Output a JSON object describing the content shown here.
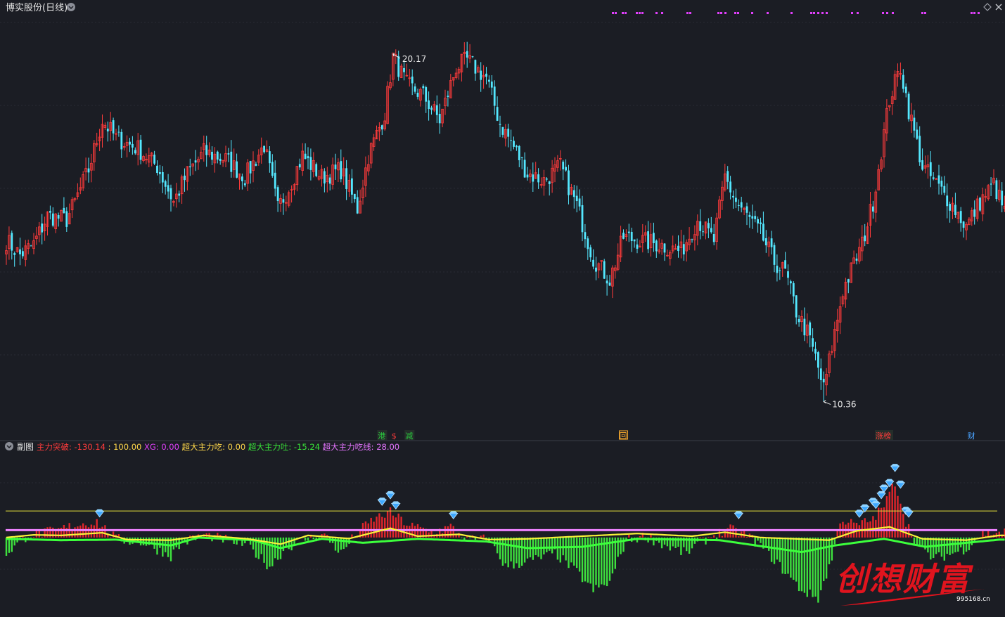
{
  "header": {
    "title": "博实股份(日线)",
    "dropdown_icon": "chevron-down-icon",
    "settings_icon": "diamond-icon",
    "close_icon": "close-icon"
  },
  "main_chart": {
    "type": "candlestick",
    "high_label": "20.17",
    "low_label": "10.36",
    "high_value": 20.17,
    "low_value": 10.36,
    "y_range": [
      9.4,
      21.3
    ],
    "up_color": "#ff3b3b",
    "down_color": "#54e8ff",
    "event_markers": [
      {
        "label": "港",
        "color": "#29c43d",
        "style": "box",
        "index": 137
      },
      {
        "label": "$",
        "color": "#ff3b3b",
        "style": "text",
        "index": 142
      },
      {
        "label": "减",
        "color": "#29c43d",
        "style": "box",
        "index": 147
      },
      {
        "label": "回",
        "color": "#ffae2e",
        "style": "outline",
        "index": 225
      },
      {
        "label": "涨榜",
        "color": "#ff3b3b",
        "style": "box",
        "index": 320
      },
      {
        "label": "财",
        "color": "#4aa3ff",
        "style": "text",
        "index": 352
      }
    ]
  },
  "sub_chart": {
    "label": "副图",
    "indicators": [
      {
        "name": "主力突破",
        "value": "-130.14",
        "color": "#ff3b3b"
      },
      {
        "name": "",
        "value": "100.00",
        "color": "#ffd84a"
      },
      {
        "name": "XG",
        "value": "0.00",
        "color": "#e040fb"
      },
      {
        "name": "超大主力吃",
        "value": "0.00",
        "color": "#ffd84a"
      },
      {
        "name": "超大主力吐",
        "value": "-15.24",
        "color": "#39e639"
      },
      {
        "name": "超大主力吃线",
        "value": "28.00",
        "color": "#e575ff"
      }
    ],
    "reference_lines": {
      "yellow": 100,
      "magenta": 28
    },
    "y_range": [
      -300,
      310
    ],
    "bar_up_color": "#e0252b",
    "bar_down_color": "#3ee03e",
    "line_colors": {
      "yellow_curve": "#f7f23a",
      "green_curve": "#3cff3c"
    }
  },
  "watermark": {
    "text": "创想财富",
    "url": "995168.cn"
  },
  "chart_data": {
    "type": "candlestick",
    "anchors": [
      [
        0,
        14.9
      ],
      [
        5,
        14.5
      ],
      [
        10,
        14.8
      ],
      [
        15,
        15.6
      ],
      [
        22,
        15.5
      ],
      [
        25,
        16.0
      ],
      [
        30,
        16.9
      ],
      [
        35,
        18.3
      ],
      [
        40,
        17.8
      ],
      [
        48,
        17.5
      ],
      [
        55,
        17.0
      ],
      [
        61,
        16.0
      ],
      [
        66,
        16.8
      ],
      [
        72,
        17.4
      ],
      [
        80,
        17.2
      ],
      [
        87,
        16.7
      ],
      [
        94,
        17.6
      ],
      [
        99,
        15.8
      ],
      [
        103,
        16.4
      ],
      [
        108,
        17.3
      ],
      [
        115,
        16.7
      ],
      [
        122,
        16.9
      ],
      [
        128,
        15.8
      ],
      [
        132,
        17.3
      ],
      [
        138,
        18.5
      ],
      [
        141,
        20.1
      ],
      [
        146,
        19.3
      ],
      [
        152,
        19.0
      ],
      [
        158,
        18.3
      ],
      [
        164,
        19.8
      ],
      [
        168,
        20.0
      ],
      [
        175,
        19.5
      ],
      [
        180,
        18.2
      ],
      [
        184,
        17.7
      ],
      [
        190,
        16.8
      ],
      [
        196,
        16.6
      ],
      [
        202,
        17.0
      ],
      [
        208,
        15.9
      ],
      [
        214,
        14.4
      ],
      [
        220,
        13.8
      ],
      [
        225,
        15.0
      ],
      [
        231,
        14.9
      ],
      [
        238,
        14.8
      ],
      [
        246,
        14.6
      ],
      [
        252,
        15.5
      ],
      [
        258,
        14.9
      ],
      [
        262,
        16.7
      ],
      [
        266,
        16.0
      ],
      [
        270,
        15.6
      ],
      [
        275,
        15.1
      ],
      [
        280,
        14.3
      ],
      [
        284,
        14.0
      ],
      [
        288,
        12.9
      ],
      [
        292,
        12.3
      ],
      [
        295,
        11.6
      ],
      [
        298,
        10.7
      ],
      [
        301,
        11.9
      ],
      [
        305,
        13.5
      ],
      [
        312,
        14.8
      ],
      [
        316,
        16.0
      ],
      [
        322,
        18.9
      ],
      [
        326,
        19.8
      ],
      [
        329,
        18.6
      ],
      [
        334,
        17.0
      ],
      [
        339,
        16.5
      ],
      [
        345,
        15.9
      ],
      [
        350,
        15.3
      ],
      [
        355,
        16.0
      ],
      [
        360,
        16.5
      ],
      [
        364,
        15.7
      ]
    ],
    "sub_anchors": [
      [
        0,
        -60
      ],
      [
        8,
        10
      ],
      [
        18,
        25
      ],
      [
        26,
        50
      ],
      [
        33,
        60
      ],
      [
        40,
        -5
      ],
      [
        50,
        -20
      ],
      [
        60,
        -70
      ],
      [
        64,
        -20
      ],
      [
        72,
        10
      ],
      [
        80,
        -8
      ],
      [
        88,
        -30
      ],
      [
        96,
        -110
      ],
      [
        102,
        -40
      ],
      [
        108,
        -10
      ],
      [
        116,
        10
      ],
      [
        122,
        -60
      ],
      [
        128,
        20
      ],
      [
        134,
        70
      ],
      [
        140,
        95
      ],
      [
        147,
        45
      ],
      [
        156,
        20
      ],
      [
        162,
        40
      ],
      [
        168,
        -10
      ],
      [
        176,
        -5
      ],
      [
        182,
        -110
      ],
      [
        188,
        -95
      ],
      [
        194,
        -80
      ],
      [
        200,
        -60
      ],
      [
        208,
        -130
      ],
      [
        214,
        -200
      ],
      [
        220,
        -170
      ],
      [
        226,
        -10
      ],
      [
        233,
        5
      ],
      [
        240,
        -30
      ],
      [
        248,
        -60
      ],
      [
        252,
        -25
      ],
      [
        258,
        10
      ],
      [
        264,
        30
      ],
      [
        270,
        10
      ],
      [
        276,
        -40
      ],
      [
        283,
        -120
      ],
      [
        290,
        -200
      ],
      [
        296,
        -230
      ],
      [
        301,
        -80
      ],
      [
        304,
        70
      ],
      [
        310,
        45
      ],
      [
        316,
        70
      ],
      [
        320,
        120
      ],
      [
        324,
        210
      ],
      [
        328,
        60
      ],
      [
        332,
        -30
      ],
      [
        338,
        -80
      ],
      [
        345,
        -60
      ],
      [
        350,
        -40
      ],
      [
        356,
        15
      ],
      [
        362,
        20
      ]
    ],
    "yellow_anchors": [
      [
        0,
        0
      ],
      [
        10,
        10
      ],
      [
        20,
        8
      ],
      [
        35,
        18
      ],
      [
        44,
        -8
      ],
      [
        60,
        -10
      ],
      [
        72,
        8
      ],
      [
        88,
        -5
      ],
      [
        100,
        -25
      ],
      [
        110,
        8
      ],
      [
        125,
        -4
      ],
      [
        140,
        35
      ],
      [
        150,
        5
      ],
      [
        165,
        12
      ],
      [
        176,
        -8
      ],
      [
        190,
        -5
      ],
      [
        230,
        15
      ],
      [
        250,
        5
      ],
      [
        262,
        20
      ],
      [
        275,
        0
      ],
      [
        300,
        -10
      ],
      [
        310,
        25
      ],
      [
        322,
        40
      ],
      [
        334,
        -5
      ],
      [
        350,
        -10
      ],
      [
        362,
        8
      ]
    ],
    "green_anchors": [
      [
        0,
        -5
      ],
      [
        20,
        -10
      ],
      [
        40,
        -8
      ],
      [
        60,
        -30
      ],
      [
        70,
        0
      ],
      [
        90,
        -10
      ],
      [
        100,
        -40
      ],
      [
        115,
        -5
      ],
      [
        130,
        -20
      ],
      [
        150,
        -5
      ],
      [
        175,
        -15
      ],
      [
        190,
        -40
      ],
      [
        210,
        -35
      ],
      [
        230,
        -5
      ],
      [
        260,
        -10
      ],
      [
        290,
        -55
      ],
      [
        302,
        -30
      ],
      [
        320,
        -5
      ],
      [
        335,
        -35
      ],
      [
        350,
        -20
      ],
      [
        362,
        -8
      ]
    ],
    "signal_indices": [
      34,
      137,
      140,
      142,
      163,
      267,
      311,
      313,
      316,
      317,
      319,
      320,
      322,
      324,
      326,
      328,
      329
    ]
  }
}
